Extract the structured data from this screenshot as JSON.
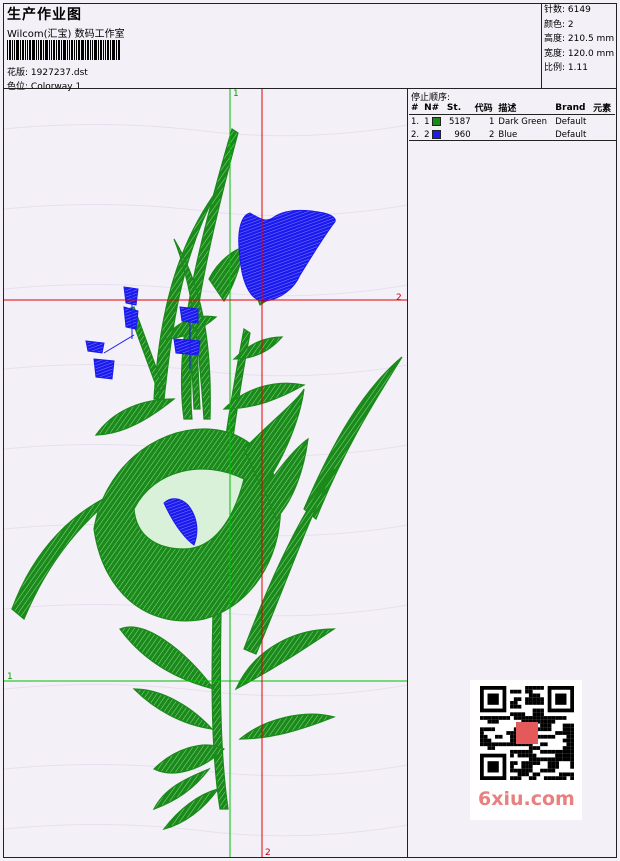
{
  "header": {
    "title": "生产作业图",
    "company": "Wilcom(汇宝) 数码工作室",
    "file_label": "花版:",
    "file_value": "1927237.dst",
    "colorway_label": "色位:",
    "colorway_value": "Colorway 1"
  },
  "stats": {
    "stitches_label": "针数:",
    "stitches_value": "6149",
    "colors_label": "颜色:",
    "colors_value": "2",
    "height_label": "高度:",
    "height_value": "210.5 mm",
    "width_label": "宽度:",
    "width_value": "120.0 mm",
    "ratio_label": "比例:",
    "ratio_value": "1.11"
  },
  "stop_sequence": {
    "title": "停止顺序:",
    "columns": [
      "#",
      "N#",
      "St.",
      "代码",
      "描述",
      "Brand",
      "元素"
    ],
    "rows": [
      {
        "index": "1.",
        "needle": "1",
        "color": "#1a8a1a",
        "stitches": "5187",
        "code": "1",
        "description": "Dark Green",
        "brand": "Default",
        "element": ""
      },
      {
        "index": "2.",
        "needle": "2",
        "color": "#1a1aee",
        "stitches": "960",
        "code": "2",
        "description": "Blue",
        "brand": "Default",
        "element": ""
      }
    ]
  },
  "guides": {
    "vertical_1": "1",
    "horizontal_2": "2",
    "horizontal_1": "1",
    "vertical_2": "2",
    "green_color": "#00c000",
    "red_color": "#e00000"
  },
  "watermark": {
    "text": "6xiu.com",
    "seal_text": "刺绣图库"
  }
}
